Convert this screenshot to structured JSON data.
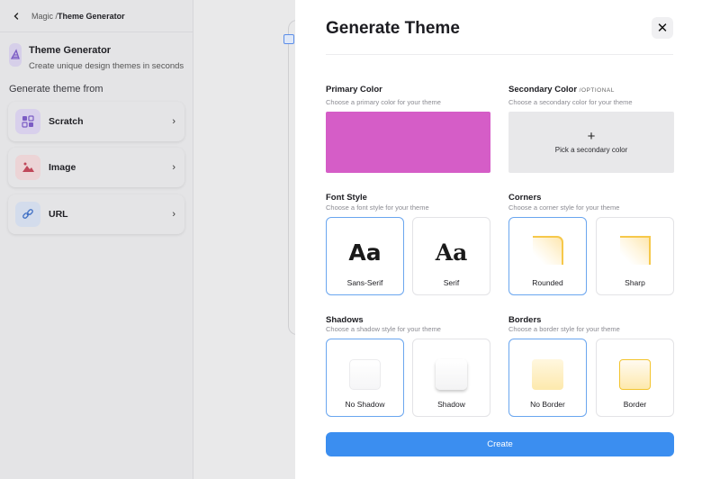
{
  "breadcrumb": {
    "parent": "Magic",
    "separator": "/",
    "current": "Theme Generator"
  },
  "theme_generator": {
    "title": "Theme Generator",
    "subtitle": "Create unique design themes in seconds"
  },
  "generate_from": {
    "heading": "Generate theme from",
    "options": [
      {
        "label": "Scratch",
        "icon": "grid-icon",
        "icon_bg": "#d8d0ec",
        "icon_color": "#7b5cc4"
      },
      {
        "label": "Image",
        "icon": "image-icon",
        "icon_bg": "#ecd4d6",
        "icon_color": "#c0485a"
      },
      {
        "label": "URL",
        "icon": "link-icon",
        "icon_bg": "#d3dcec",
        "icon_color": "#3f6fc4"
      }
    ]
  },
  "modal": {
    "title": "Generate Theme",
    "close_label": "✕",
    "primary": {
      "heading": "Primary Color",
      "subtitle": "Choose a primary color for your theme",
      "color": "#d55dc7"
    },
    "secondary": {
      "heading": "Secondary Color",
      "optional": "/OPTIONAL",
      "subtitle": "Choose a secondary color for your theme",
      "plus": "+",
      "pick_label": "Pick a secondary color"
    },
    "font_style": {
      "heading": "Font Style",
      "subtitle": "Choose a font style for your theme",
      "options": [
        {
          "glyph": "Aa",
          "label": "Sans-Serif",
          "selected": true
        },
        {
          "glyph": "Aa",
          "label": "Serif",
          "selected": false
        }
      ]
    },
    "corners": {
      "heading": "Corners",
      "subtitle": "Choose a corner style for your theme",
      "options": [
        {
          "label": "Rounded",
          "selected": true
        },
        {
          "label": "Sharp",
          "selected": false
        }
      ]
    },
    "shadows": {
      "heading": "Shadows",
      "subtitle": "Choose a shadow style for your theme",
      "options": [
        {
          "label": "No Shadow",
          "selected": true
        },
        {
          "label": "Shadow",
          "selected": false
        }
      ]
    },
    "borders": {
      "heading": "Borders",
      "subtitle": "Choose a border style for your theme",
      "options": [
        {
          "label": "No Border",
          "selected": true
        },
        {
          "label": "Border",
          "selected": false
        }
      ]
    },
    "create_label": "Create",
    "accent": "#3b8ef0"
  }
}
